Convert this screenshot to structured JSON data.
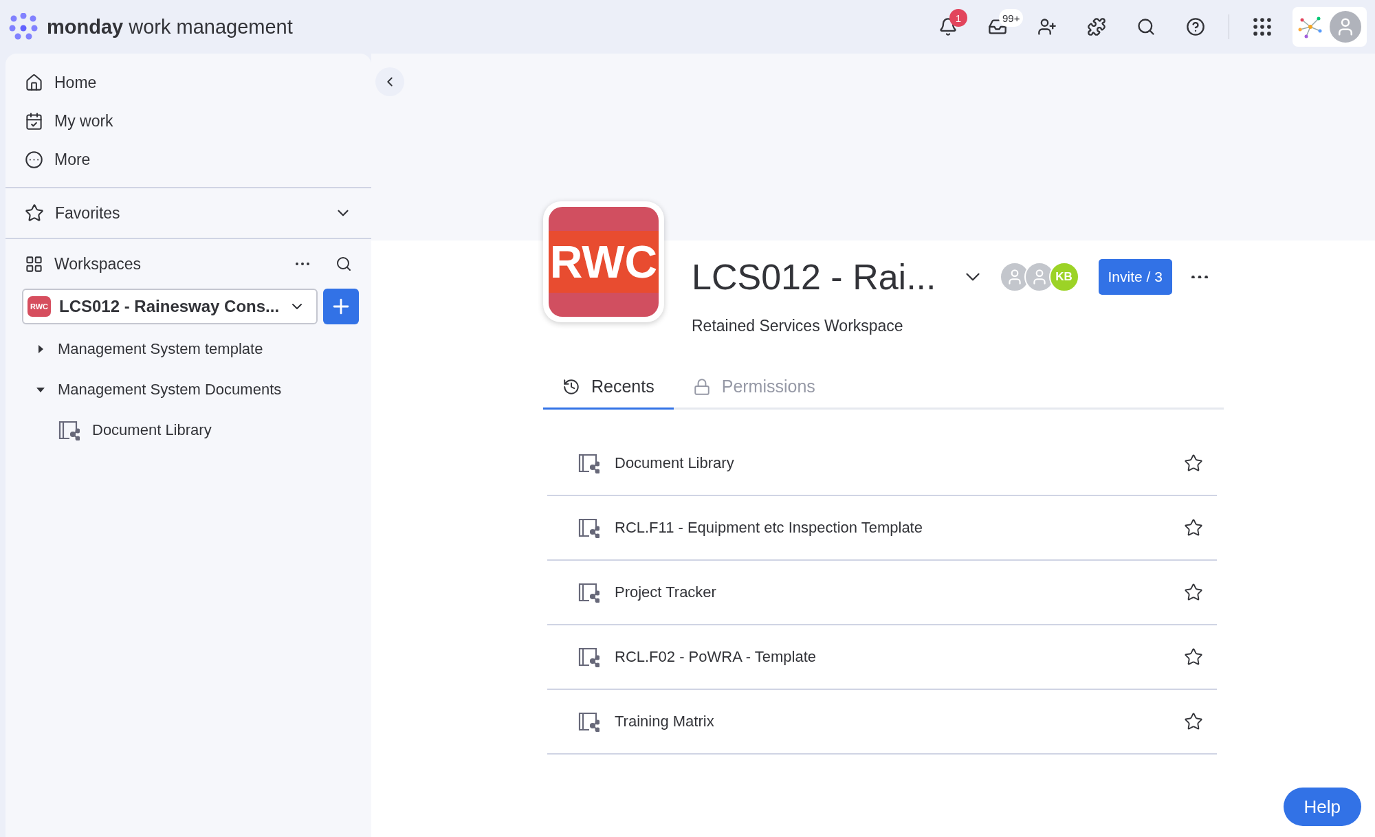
{
  "brand": {
    "name": "monday",
    "product": "work management"
  },
  "top_bar": {
    "notifications_badge": "1",
    "inbox_badge": "99+"
  },
  "sidebar": {
    "nav": [
      {
        "label": "Home"
      },
      {
        "label": "My work"
      },
      {
        "label": "More"
      }
    ],
    "favorites": {
      "label": "Favorites",
      "expanded": false
    },
    "workspaces": {
      "label": "Workspaces",
      "current": {
        "logo": "RWC",
        "name": "LCS012 - Rainesway Cons..."
      },
      "tree": [
        {
          "label": "Management System template",
          "expanded": false
        },
        {
          "label": "Management System Documents",
          "expanded": true,
          "children": [
            {
              "label": "Document Library"
            }
          ]
        }
      ]
    }
  },
  "workspace": {
    "logo": "RWC",
    "title": "LCS012 - Rai...",
    "subtitle": "Retained Services Workspace",
    "members": [
      {
        "kind": "photo"
      },
      {
        "kind": "photo"
      },
      {
        "kind": "initials",
        "initials": "KB",
        "color": "#9cd326"
      }
    ],
    "invite": "Invite / 3"
  },
  "tabs": [
    {
      "label": "Recents",
      "selected": true
    },
    {
      "label": "Permissions",
      "selected": false
    }
  ],
  "recents": [
    {
      "name": "Document Library"
    },
    {
      "name": "RCL.F11 - Equipment etc Inspection Template"
    },
    {
      "name": "Project Tracker"
    },
    {
      "name": "RCL.F02 - PoWRA - Template"
    },
    {
      "name": "Training Matrix"
    }
  ],
  "help_button": "Help"
}
